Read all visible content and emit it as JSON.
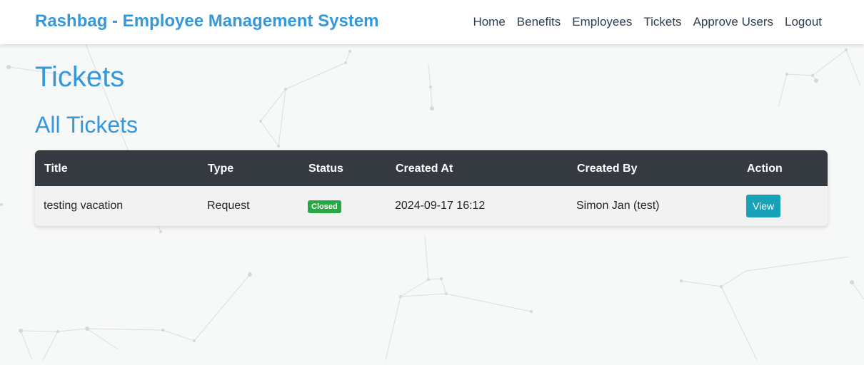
{
  "navbar": {
    "brand": "Rashbag - Employee Management System",
    "links": [
      "Home",
      "Benefits",
      "Employees",
      "Tickets",
      "Approve Users",
      "Logout"
    ]
  },
  "page": {
    "title": "Tickets",
    "section_title": "All Tickets"
  },
  "table": {
    "headers": [
      "Title",
      "Type",
      "Status",
      "Created At",
      "Created By",
      "Action"
    ],
    "rows": [
      {
        "title": "testing vacation",
        "type": "Request",
        "status": "Closed",
        "created_at": "2024-09-17 16:12",
        "created_by": "Simon Jan (test)",
        "action": "View"
      }
    ]
  },
  "colors": {
    "brand": "#3498db",
    "table_header_bg": "#343a40",
    "badge_closed": "#28a745",
    "view_button": "#17a2b8"
  }
}
